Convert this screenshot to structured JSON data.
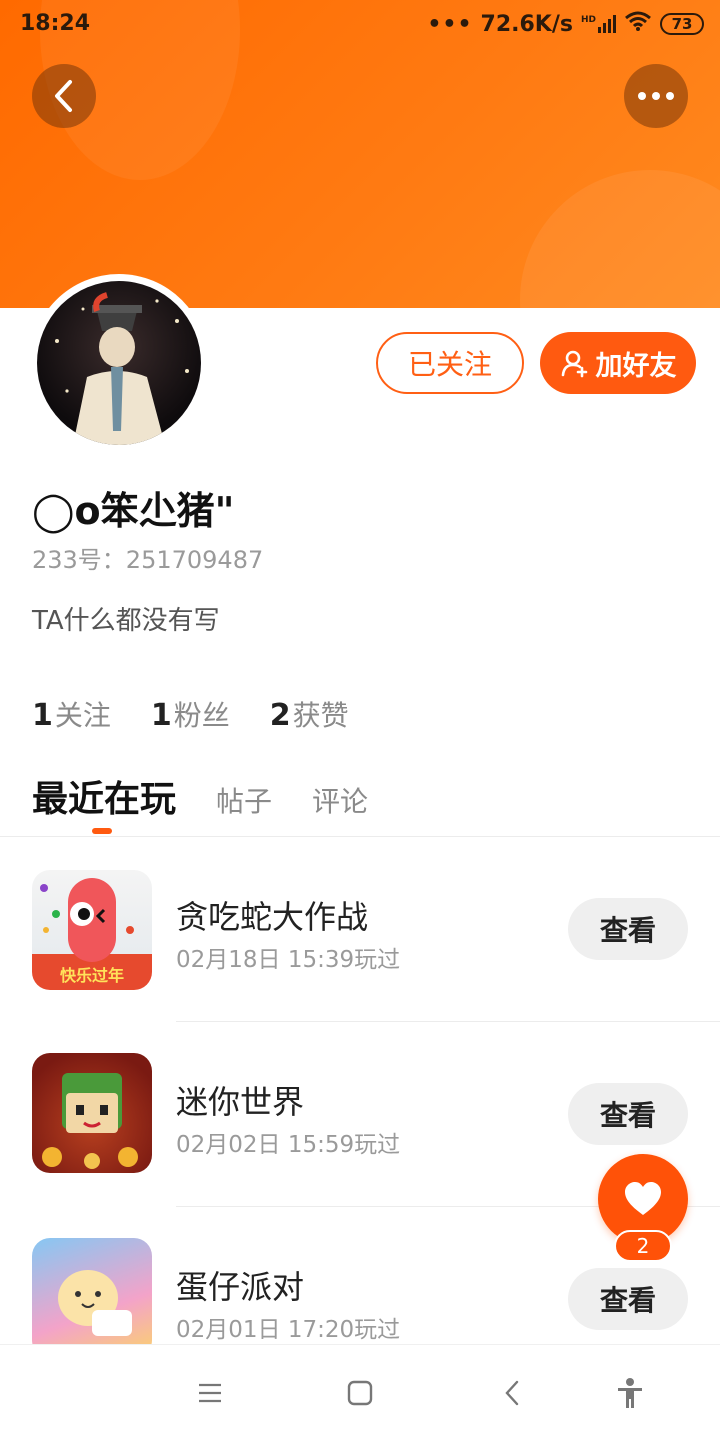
{
  "status_bar": {
    "time": "18:24",
    "network_speed": "72.6K/s",
    "network_type": "HD",
    "battery": "73"
  },
  "header": {
    "back_icon": "chevron-left-icon",
    "more_icon": "more-dots-icon",
    "banner_color": "#ff6f0a"
  },
  "profile": {
    "username": "◯o笨尐猪\"",
    "uid": "233号：251709487",
    "bio": "TA什么都没有写",
    "follow_label": "已关注",
    "add_friend_label": "加好友",
    "accent_color": "#ff5a10"
  },
  "stats": [
    {
      "num": "1",
      "label": "关注"
    },
    {
      "num": "1",
      "label": "粉丝"
    },
    {
      "num": "2",
      "label": "获赞"
    }
  ],
  "tabs": {
    "active": "最近在玩",
    "items": [
      "帖子",
      "评论"
    ]
  },
  "games": [
    {
      "title": "贪吃蛇大作战",
      "time": "02月18日 15:39玩过",
      "button": "查看",
      "icon_text": "快乐过年"
    },
    {
      "title": "迷你世界",
      "time": "02月02日 15:59玩过",
      "button": "查看"
    },
    {
      "title": "蛋仔派对",
      "time": "02月01日 17:20玩过",
      "button": "查看"
    }
  ],
  "like_fab": {
    "icon": "heart-icon",
    "count": "2"
  },
  "system_nav": {
    "icons": [
      "menu-icon",
      "home-square-icon",
      "back-icon",
      "accessibility-icon"
    ]
  }
}
